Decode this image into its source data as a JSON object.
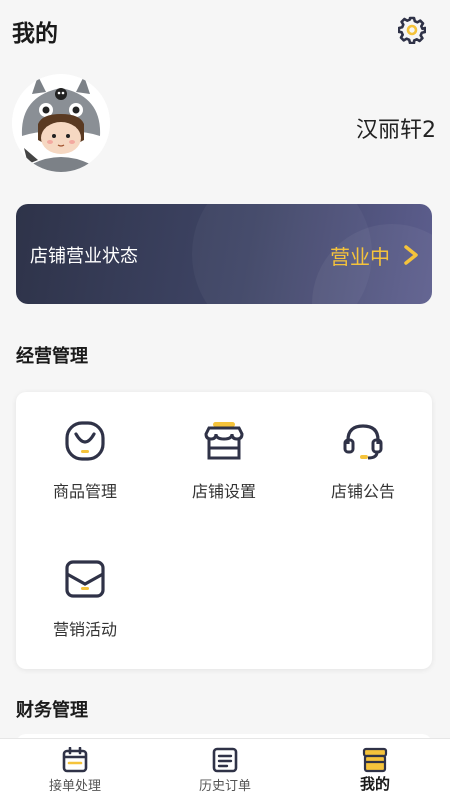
{
  "header": {
    "title": "我的",
    "settings_icon": "gear-icon"
  },
  "profile": {
    "username": "汉丽轩2",
    "avatar_icon": "avatar-image"
  },
  "store_status": {
    "label": "店铺营业状态",
    "value": "营业中",
    "accent": "#f5c33b"
  },
  "sections": {
    "operations": {
      "title": "经营管理",
      "items": [
        {
          "label": "商品管理",
          "icon": "product-icon"
        },
        {
          "label": "店铺设置",
          "icon": "store-icon"
        },
        {
          "label": "店铺公告",
          "icon": "headset-icon"
        },
        {
          "label": "营销活动",
          "icon": "marketing-icon"
        }
      ]
    },
    "finance": {
      "title": "财务管理"
    }
  },
  "tabbar": {
    "tabs": [
      {
        "label": "接单处理",
        "icon": "calendar-icon",
        "active": false
      },
      {
        "label": "历史订单",
        "icon": "list-icon",
        "active": false
      },
      {
        "label": "我的",
        "icon": "store-icon",
        "active": true
      }
    ]
  },
  "colors": {
    "primary_dark": "#2f3247",
    "accent_yellow": "#f5c33b",
    "background": "#f6f6f6"
  }
}
